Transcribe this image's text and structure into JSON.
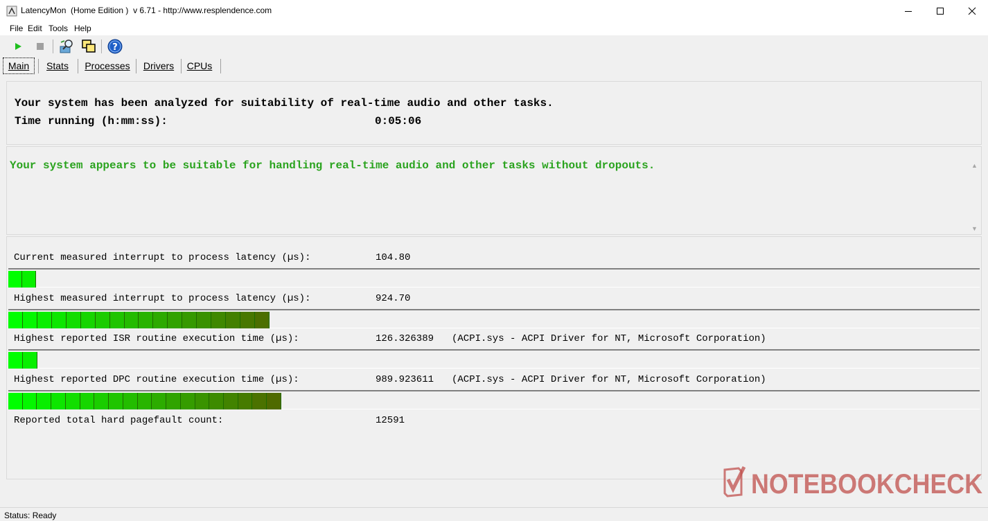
{
  "window": {
    "title": "LatencyMon  (Home Edition )  v 6.71 - http://www.resplendence.com",
    "icon": "latencymon-app-icon",
    "controls": [
      "minimize-icon",
      "maximize-icon",
      "close-icon"
    ]
  },
  "menu": [
    "File",
    "Edit",
    "Tools",
    "Help"
  ],
  "toolbar": {
    "buttons": [
      "play-icon",
      "stop-icon",
      "driver-search-icon",
      "windows-icon",
      "help-icon"
    ]
  },
  "tabs": [
    "Main",
    "Stats",
    "Processes",
    "Drivers",
    "CPUs"
  ],
  "active_tab": "Main",
  "summary": {
    "analyzed_text": "Your system has been analyzed for suitability of real-time audio and other tasks.",
    "time_label": "Time running (h:mm:ss):",
    "time_value": "0:05:06"
  },
  "conclusion": {
    "text": "Your system appears to be suitable for handling real-time audio and other tasks without dropouts.",
    "color": "#2aa31e"
  },
  "stats": [
    {
      "label": "Current measured interrupt to process latency (µs):",
      "value": "104.80",
      "detail": "",
      "bar_level": 0.0284
    },
    {
      "label": "Highest measured interrupt to process latency (µs):",
      "value": "924.70",
      "detail": "",
      "bar_level": 0.2686
    },
    {
      "label": "Highest reported ISR routine execution time (µs):",
      "value": "126.326389",
      "detail": "(ACPI.sys - ACPI Driver for NT, Microsoft Corporation)",
      "bar_level": 0.0298
    },
    {
      "label": "Highest reported DPC routine execution time (µs):",
      "value": "989.923611",
      "detail": "(ACPI.sys - ACPI Driver for NT, Microsoft Corporation)",
      "bar_level": 0.281
    },
    {
      "label": "Reported total hard pagefault count:",
      "value": "12591",
      "detail": ""
    }
  ],
  "bar_colors": {
    "low": "#00ff00",
    "high": "#4f6a00"
  },
  "status": "Status: Ready",
  "watermark": {
    "text": "NOTEBOOKCHECK",
    "color": "#c0504d"
  }
}
